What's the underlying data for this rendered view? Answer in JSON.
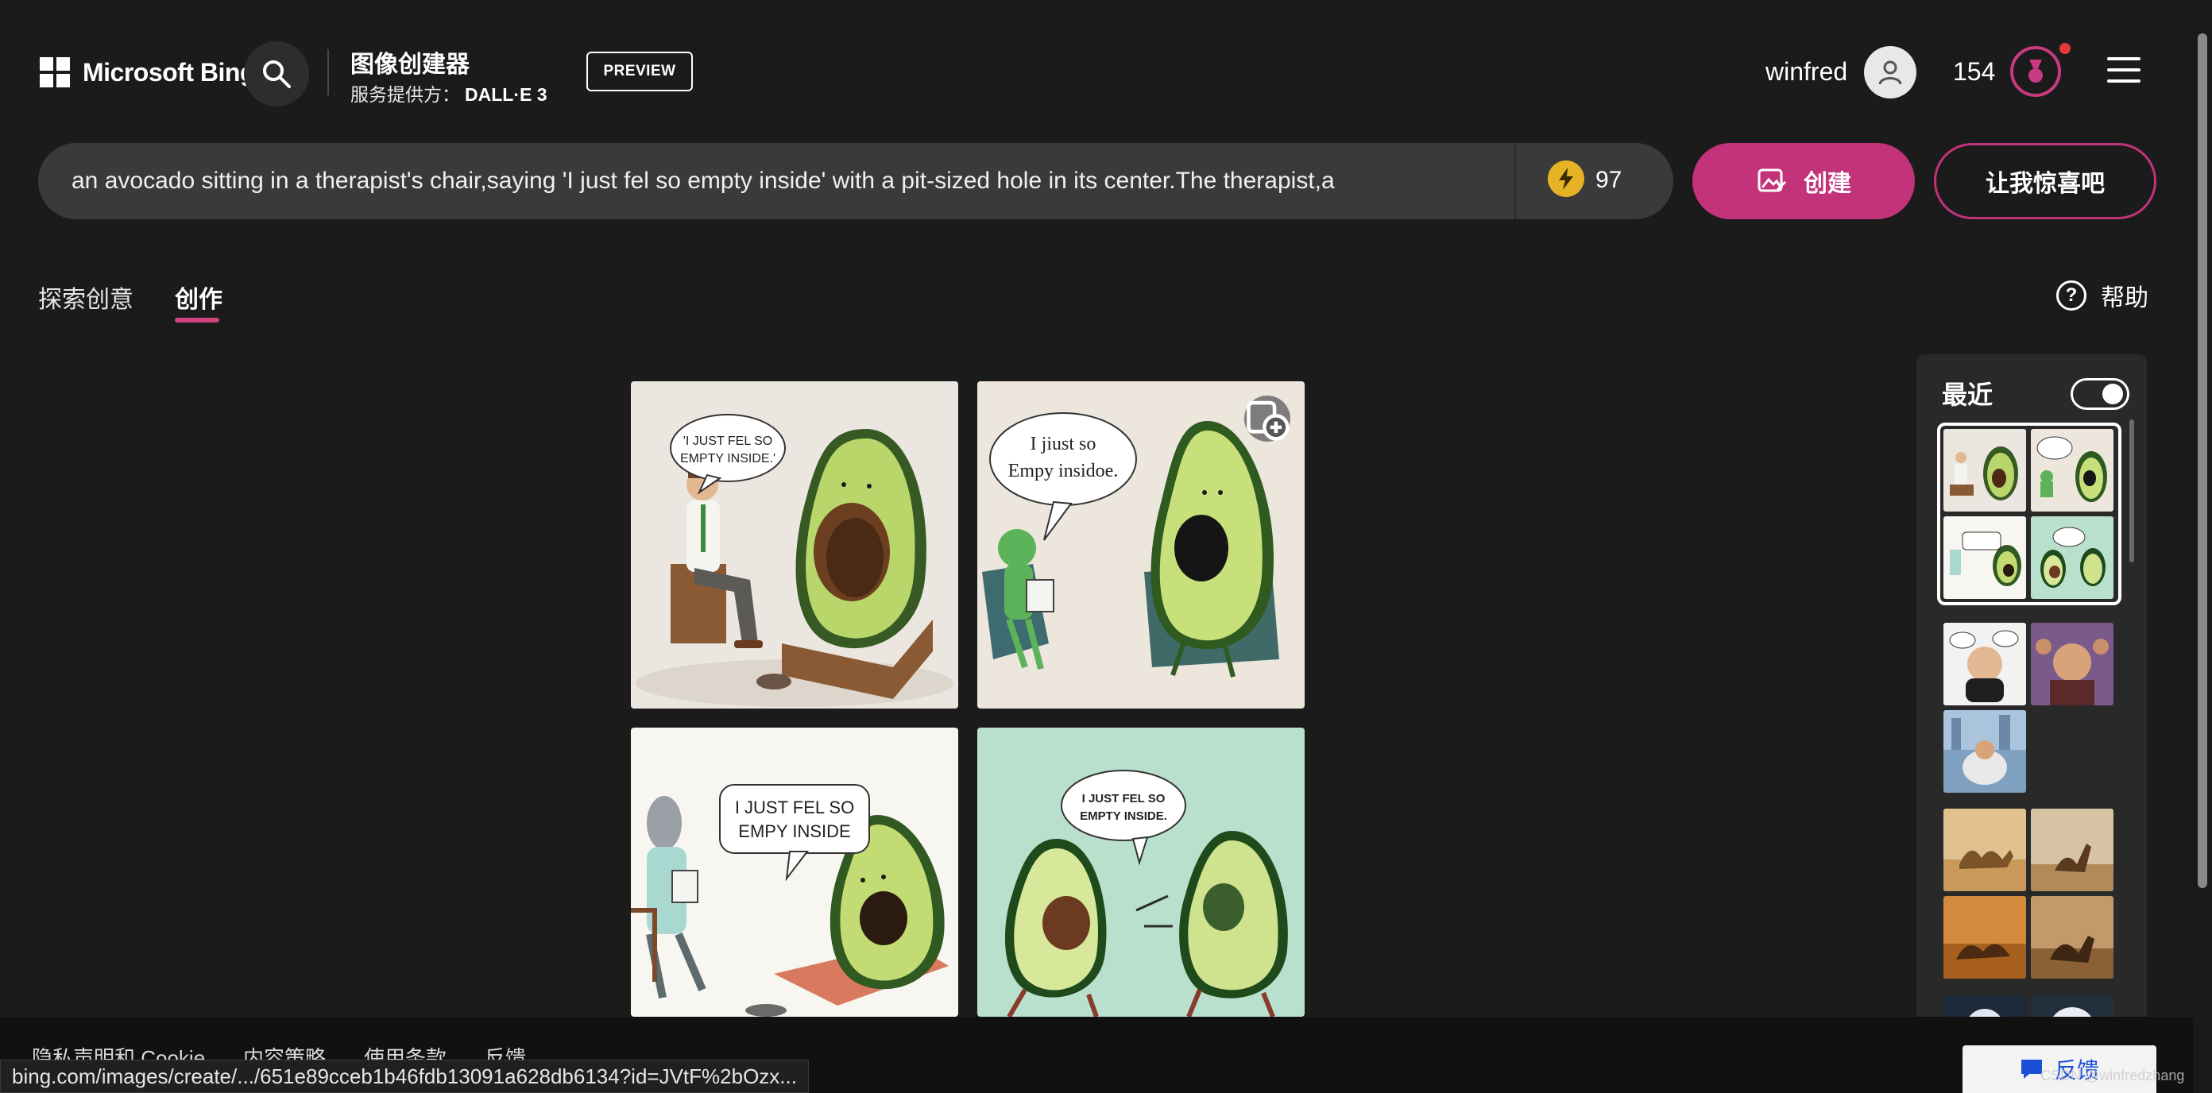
{
  "header": {
    "brand": "Microsoft Bing",
    "app_title": "图像创建器",
    "provider_label": "服务提供方：",
    "provider_name": "DALL·E 3",
    "preview_label": "PREVIEW",
    "username": "winfred",
    "reward_points": "154"
  },
  "prompt": {
    "text": "an avocado sitting in a therapist's chair,saying 'I just fel so empty inside' with a pit-sized hole in its center.The therapist,a",
    "boosts": "97",
    "create_label": "创建",
    "surprise_label": "让我惊喜吧"
  },
  "tabs": [
    {
      "label": "探索创意",
      "active": false
    },
    {
      "label": "创作",
      "active": true
    }
  ],
  "help_label": "帮助",
  "help_glyph": "?",
  "images": [
    {
      "bubble_lines": [
        "'I JUST FEL SO",
        "EMPTY INSIDE.'"
      ]
    },
    {
      "bubble_lines": [
        "I jiust so",
        "Empy insidoe."
      ]
    },
    {
      "bubble_lines": [
        "I JUST FEL SO",
        "EMPY INSIDE"
      ]
    },
    {
      "bubble_lines": [
        "I JUST FEL SO",
        "EMPTY INSIDE."
      ]
    }
  ],
  "recent": {
    "title": "最近",
    "toggle_on": true
  },
  "footer": {
    "links": [
      "隐私声明和 Cookie",
      "内容策略",
      "使用条款",
      "反馈"
    ],
    "status_url": "bing.com/images/create/.../651e89cceb1b46fdb13091a628db6134?id=JVtF%2bOzx...",
    "feedback_label": "反馈",
    "watermark": "CSDN @winfredzhang"
  },
  "colors": {
    "background": "#1c1b1b",
    "accent_pink": "#c3337a",
    "prompt_bg": "#3b3a3a",
    "boost_gold": "#e7b326"
  },
  "icons": [
    "windows-logo-icon",
    "search-icon",
    "user-avatar-icon",
    "rewards-medal-icon",
    "hamburger-menu-icon",
    "boost-bolt-icon",
    "create-image-icon",
    "help-icon",
    "collection-add-icon",
    "feedback-icon"
  ]
}
